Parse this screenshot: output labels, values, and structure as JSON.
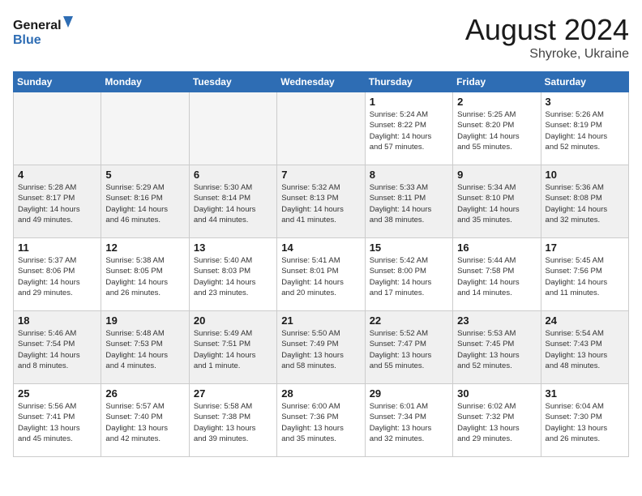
{
  "header": {
    "logo_general": "General",
    "logo_blue": "Blue",
    "month_year": "August 2024",
    "location": "Shyroke, Ukraine"
  },
  "days_of_week": [
    "Sunday",
    "Monday",
    "Tuesday",
    "Wednesday",
    "Thursday",
    "Friday",
    "Saturday"
  ],
  "weeks": [
    [
      {
        "day": "",
        "info": "",
        "empty": true
      },
      {
        "day": "",
        "info": "",
        "empty": true
      },
      {
        "day": "",
        "info": "",
        "empty": true
      },
      {
        "day": "",
        "info": "",
        "empty": true
      },
      {
        "day": "1",
        "info": "Sunrise: 5:24 AM\nSunset: 8:22 PM\nDaylight: 14 hours\nand 57 minutes."
      },
      {
        "day": "2",
        "info": "Sunrise: 5:25 AM\nSunset: 8:20 PM\nDaylight: 14 hours\nand 55 minutes."
      },
      {
        "day": "3",
        "info": "Sunrise: 5:26 AM\nSunset: 8:19 PM\nDaylight: 14 hours\nand 52 minutes."
      }
    ],
    [
      {
        "day": "4",
        "info": "Sunrise: 5:28 AM\nSunset: 8:17 PM\nDaylight: 14 hours\nand 49 minutes.",
        "shaded": true
      },
      {
        "day": "5",
        "info": "Sunrise: 5:29 AM\nSunset: 8:16 PM\nDaylight: 14 hours\nand 46 minutes.",
        "shaded": true
      },
      {
        "day": "6",
        "info": "Sunrise: 5:30 AM\nSunset: 8:14 PM\nDaylight: 14 hours\nand 44 minutes.",
        "shaded": true
      },
      {
        "day": "7",
        "info": "Sunrise: 5:32 AM\nSunset: 8:13 PM\nDaylight: 14 hours\nand 41 minutes.",
        "shaded": true
      },
      {
        "day": "8",
        "info": "Sunrise: 5:33 AM\nSunset: 8:11 PM\nDaylight: 14 hours\nand 38 minutes.",
        "shaded": true
      },
      {
        "day": "9",
        "info": "Sunrise: 5:34 AM\nSunset: 8:10 PM\nDaylight: 14 hours\nand 35 minutes.",
        "shaded": true
      },
      {
        "day": "10",
        "info": "Sunrise: 5:36 AM\nSunset: 8:08 PM\nDaylight: 14 hours\nand 32 minutes.",
        "shaded": true
      }
    ],
    [
      {
        "day": "11",
        "info": "Sunrise: 5:37 AM\nSunset: 8:06 PM\nDaylight: 14 hours\nand 29 minutes."
      },
      {
        "day": "12",
        "info": "Sunrise: 5:38 AM\nSunset: 8:05 PM\nDaylight: 14 hours\nand 26 minutes."
      },
      {
        "day": "13",
        "info": "Sunrise: 5:40 AM\nSunset: 8:03 PM\nDaylight: 14 hours\nand 23 minutes."
      },
      {
        "day": "14",
        "info": "Sunrise: 5:41 AM\nSunset: 8:01 PM\nDaylight: 14 hours\nand 20 minutes."
      },
      {
        "day": "15",
        "info": "Sunrise: 5:42 AM\nSunset: 8:00 PM\nDaylight: 14 hours\nand 17 minutes."
      },
      {
        "day": "16",
        "info": "Sunrise: 5:44 AM\nSunset: 7:58 PM\nDaylight: 14 hours\nand 14 minutes."
      },
      {
        "day": "17",
        "info": "Sunrise: 5:45 AM\nSunset: 7:56 PM\nDaylight: 14 hours\nand 11 minutes."
      }
    ],
    [
      {
        "day": "18",
        "info": "Sunrise: 5:46 AM\nSunset: 7:54 PM\nDaylight: 14 hours\nand 8 minutes.",
        "shaded": true
      },
      {
        "day": "19",
        "info": "Sunrise: 5:48 AM\nSunset: 7:53 PM\nDaylight: 14 hours\nand 4 minutes.",
        "shaded": true
      },
      {
        "day": "20",
        "info": "Sunrise: 5:49 AM\nSunset: 7:51 PM\nDaylight: 14 hours\nand 1 minute.",
        "shaded": true
      },
      {
        "day": "21",
        "info": "Sunrise: 5:50 AM\nSunset: 7:49 PM\nDaylight: 13 hours\nand 58 minutes.",
        "shaded": true
      },
      {
        "day": "22",
        "info": "Sunrise: 5:52 AM\nSunset: 7:47 PM\nDaylight: 13 hours\nand 55 minutes.",
        "shaded": true
      },
      {
        "day": "23",
        "info": "Sunrise: 5:53 AM\nSunset: 7:45 PM\nDaylight: 13 hours\nand 52 minutes.",
        "shaded": true
      },
      {
        "day": "24",
        "info": "Sunrise: 5:54 AM\nSunset: 7:43 PM\nDaylight: 13 hours\nand 48 minutes.",
        "shaded": true
      }
    ],
    [
      {
        "day": "25",
        "info": "Sunrise: 5:56 AM\nSunset: 7:41 PM\nDaylight: 13 hours\nand 45 minutes."
      },
      {
        "day": "26",
        "info": "Sunrise: 5:57 AM\nSunset: 7:40 PM\nDaylight: 13 hours\nand 42 minutes."
      },
      {
        "day": "27",
        "info": "Sunrise: 5:58 AM\nSunset: 7:38 PM\nDaylight: 13 hours\nand 39 minutes."
      },
      {
        "day": "28",
        "info": "Sunrise: 6:00 AM\nSunset: 7:36 PM\nDaylight: 13 hours\nand 35 minutes."
      },
      {
        "day": "29",
        "info": "Sunrise: 6:01 AM\nSunset: 7:34 PM\nDaylight: 13 hours\nand 32 minutes."
      },
      {
        "day": "30",
        "info": "Sunrise: 6:02 AM\nSunset: 7:32 PM\nDaylight: 13 hours\nand 29 minutes."
      },
      {
        "day": "31",
        "info": "Sunrise: 6:04 AM\nSunset: 7:30 PM\nDaylight: 13 hours\nand 26 minutes."
      }
    ]
  ]
}
